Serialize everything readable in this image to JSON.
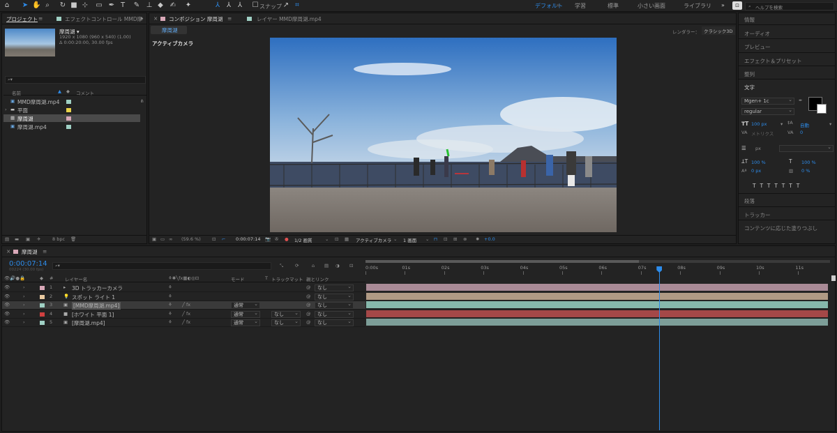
{
  "workspaces": [
    "デフォルト",
    "学習",
    "標準",
    "小さい画面",
    "ライブラリ"
  ],
  "search_help": "ヘルプを検索",
  "toolbar": {
    "snap_label": "スナップ"
  },
  "project": {
    "tab_project": "プロジェクト",
    "tab_effects": "エフェクトコントロール MMD摩",
    "comp_name": "摩周湖 ▾",
    "comp_res": "1920 x 1080  (960 x 540) (1.00)",
    "comp_dur": "Δ 0:00:20:00, 30.00 fps",
    "col_name": "名前",
    "col_comment": "コメント",
    "items": [
      {
        "name": "MMD摩周湖.mp4",
        "color": "#9fd0c4"
      },
      {
        "name": "平面",
        "color": "#e8d24a"
      },
      {
        "name": "摩周湖",
        "color": "#d9a8b8"
      },
      {
        "name": "摩周湖.mp4",
        "color": "#9fd0c4"
      }
    ],
    "bpc": "8 bpc"
  },
  "comp": {
    "tab_comp": "コンポジション 摩周湖",
    "tab_layer": "レイヤー MMD摩周湖.mp4",
    "subtab": "摩周湖",
    "renderer_label": "レンダラー：",
    "renderer_value": "クラシック3D",
    "active_camera": "アクティブカメラ",
    "zoom": "(59.6 %)",
    "time": "0:00:07:14",
    "resolution": "1/2 画質",
    "view": "アクティブカメラ",
    "views": "1 画面",
    "exposure": "+0.0"
  },
  "right_panels": {
    "info": "情報",
    "audio": "オーディオ",
    "preview": "プレビュー",
    "effects": "エフェクト＆プリセット",
    "align": "整列",
    "text": "文字",
    "font": "Mgen+ 1c",
    "style": "regular",
    "size": "100 px",
    "leading": "自動",
    "kerning": "メトリクス",
    "tracking": "0",
    "stroke": "px",
    "vscale": "100 %",
    "hscale": "100 %",
    "baseline": "0 px",
    "tsume": "0 %",
    "paragraph": "段落",
    "tracker": "トラッカー",
    "content_aware": "コンテンツに応じた塗りつぶし"
  },
  "timeline": {
    "tab": "摩周湖",
    "current_time": "0:00:07:14",
    "frames": "00224 (30.00 fps)",
    "col_layer_name": "レイヤー名",
    "col_mode": "モード",
    "col_t": "T",
    "col_trackmatte": "トラックマット",
    "col_parent": "親とリンク",
    "ticks": [
      "0:00s",
      "01s",
      "02s",
      "03s",
      "04s",
      "05s",
      "06s",
      "07s",
      "08s",
      "09s",
      "10s",
      "11s"
    ],
    "playhead_seconds": 7.47,
    "layers": [
      {
        "num": "1",
        "name": "3D トラッカーカメラ",
        "color": "#d9a8b8",
        "icon": "camera-icon",
        "mode": "",
        "track": "",
        "parent": "なし",
        "bar": "#a98a96"
      },
      {
        "num": "2",
        "name": "スポット ライト 1",
        "color": "#e8c9a0",
        "icon": "light-icon",
        "mode": "",
        "track": "",
        "parent": "なし",
        "bar": "#b09a84"
      },
      {
        "num": "3",
        "name": "[MMD摩周湖.mp4]",
        "color": "#9fd0c4",
        "icon": "footage-icon",
        "mode": "通常",
        "track": "",
        "parent": "なし",
        "bar": "#86b8ac"
      },
      {
        "num": "4",
        "name": "[ホワイト 平面 1]",
        "color": "#d04040",
        "icon": "solid-icon",
        "mode": "通常",
        "track": "なし",
        "parent": "なし",
        "bar": "#a44848"
      },
      {
        "num": "5",
        "name": "[摩周湖.mp4]",
        "color": "#9fd0c4",
        "icon": "footage-icon",
        "mode": "通常",
        "track": "なし",
        "parent": "なし",
        "bar": "#7d9e98"
      }
    ]
  }
}
